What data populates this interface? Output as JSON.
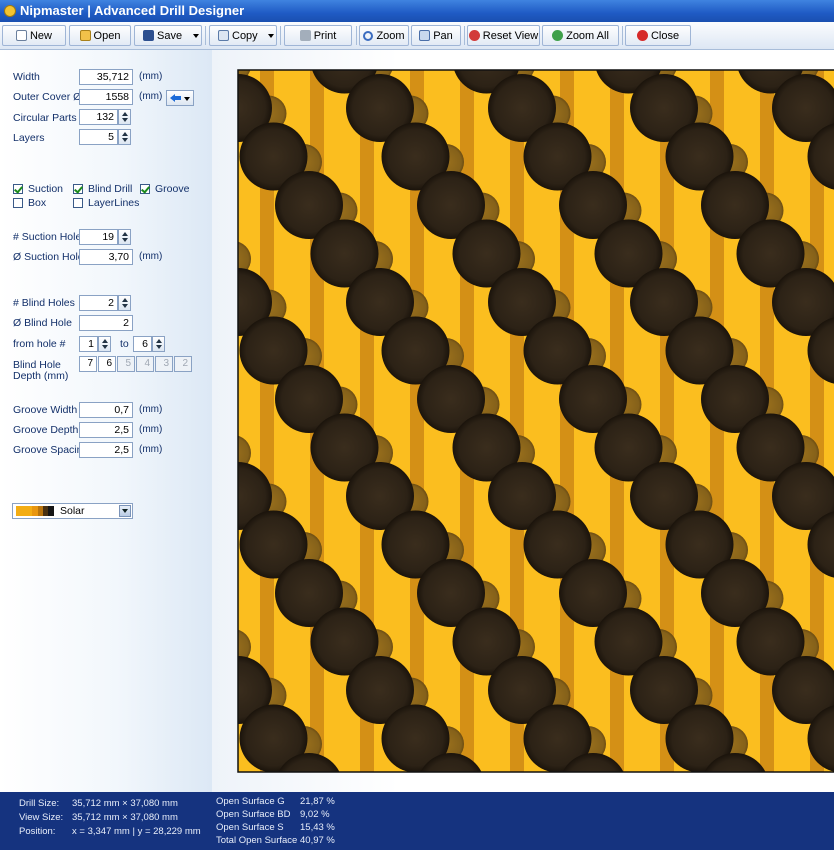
{
  "window": {
    "title": "Nipmaster | Advanced Drill Designer"
  },
  "toolbar": {
    "new": "New",
    "open": "Open",
    "save": "Save",
    "copy": "Copy",
    "print": "Print",
    "zoom": "Zoom",
    "pan": "Pan",
    "reset_view": "Reset View",
    "zoom_all": "Zoom All",
    "close": "Close"
  },
  "params": {
    "width_label": "Width",
    "width_value": "35,712",
    "width_unit": "(mm)",
    "outer_cover_label": "Outer Cover Ø",
    "outer_cover_value": "1558",
    "outer_cover_unit": "(mm)",
    "circular_parts_label": "Circular Parts",
    "circular_parts_value": "132",
    "layers_label": "Layers",
    "layers_value": "5"
  },
  "options": {
    "suction": {
      "label": "Suction",
      "checked": true
    },
    "blind_drill": {
      "label": "Blind Drill",
      "checked": true
    },
    "groove": {
      "label": "Groove",
      "checked": true
    },
    "box": {
      "label": "Box",
      "checked": false
    },
    "layer_lines": {
      "label": "LayerLines",
      "checked": false
    }
  },
  "suction": {
    "holes_label": "# Suction Holes",
    "holes_value": "19",
    "diameter_label": "Ø Suction Hole",
    "diameter_value": "3,70",
    "diameter_unit": "(mm)"
  },
  "blind": {
    "holes_label": "# Blind Holes",
    "holes_value": "2",
    "diameter_label": "Ø Blind Hole",
    "diameter_value": "2",
    "from_label": "from hole #",
    "from_value": "1",
    "to_label": "to",
    "to_value": "6",
    "depth_label_1": "Blind Hole",
    "depth_label_2": "Depth (mm)",
    "depths": [
      {
        "value": "7",
        "enabled": true
      },
      {
        "value": "6",
        "enabled": true
      },
      {
        "value": "5",
        "enabled": false
      },
      {
        "value": "4",
        "enabled": false
      },
      {
        "value": "3",
        "enabled": false
      },
      {
        "value": "2",
        "enabled": false
      }
    ]
  },
  "groove": {
    "width_label": "Groove Width",
    "width_value": "0,7",
    "width_unit": "(mm)",
    "depth_label": "Groove Depth",
    "depth_value": "2,5",
    "depth_unit": "(mm)",
    "spacing_label": "Groove Spacing",
    "spacing_value": "2,5",
    "spacing_unit": "(mm)"
  },
  "color_scheme": {
    "selected": "Solar",
    "swatches": [
      "#f3ad14",
      "#e89610",
      "#b8740e",
      "#4a3212",
      "#151515"
    ]
  },
  "colors": {
    "background": "#fbbe1f",
    "groove": "#d49016",
    "suction_hole": "#2f2417",
    "blind_hole": "#8a6418"
  },
  "status": {
    "drill_size_label": "Drill Size:",
    "drill_size_value": "35,712 mm × 37,080 mm",
    "view_size_label": "View Size:",
    "view_size_value": "35,712 mm × 37,080 mm",
    "position_label": "Position:",
    "position_value": "x = 3,347 mm | y = 28,229 mm",
    "surface": [
      {
        "label": "Open Surface G",
        "value": "21,87 %"
      },
      {
        "label": "Open Surface BD",
        "value": "9,02 %"
      },
      {
        "label": "Open Surface S",
        "value": "15,43 %"
      },
      {
        "label": "Total Open Surface",
        "value": "40,97 %"
      }
    ]
  }
}
